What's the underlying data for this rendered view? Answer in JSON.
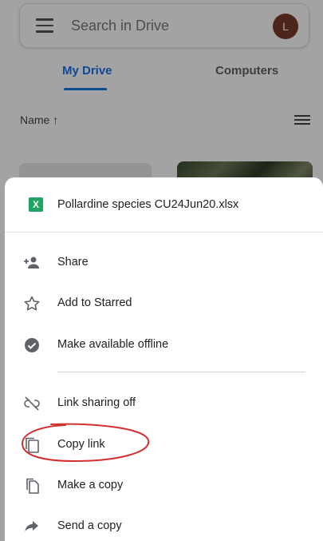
{
  "search": {
    "placeholder": "Search in Drive"
  },
  "account": {
    "initial": "L",
    "color": "#7b3a2a"
  },
  "tabs": [
    {
      "label": "My Drive",
      "selected": true
    },
    {
      "label": "Computers",
      "selected": false
    }
  ],
  "sort": {
    "label": "Name ↑"
  },
  "accent_color": "#1a73e8",
  "sheet": {
    "file": {
      "icon": "spreadsheet-icon",
      "icon_letter": "X",
      "icon_color": "#1fa463",
      "name": "Pollardine species CU24Jun20.xlsx"
    },
    "items": [
      {
        "label": "Share",
        "icon": "share-person-add-icon"
      },
      {
        "label": "Add to Starred",
        "icon": "star-outline-icon"
      },
      {
        "label": "Make available offline",
        "icon": "offline-check-icon"
      },
      {
        "label": "Link sharing off",
        "icon": "link-off-icon"
      },
      {
        "label": "Copy link",
        "icon": "copy-icon",
        "annotated": true
      },
      {
        "label": "Make a copy",
        "icon": "file-copy-icon"
      },
      {
        "label": "Send a copy",
        "icon": "send-arrow-icon"
      }
    ]
  },
  "annotation": {
    "shape": "hand-drawn-ellipse",
    "color": "#d32f2f",
    "target": "Copy link"
  }
}
